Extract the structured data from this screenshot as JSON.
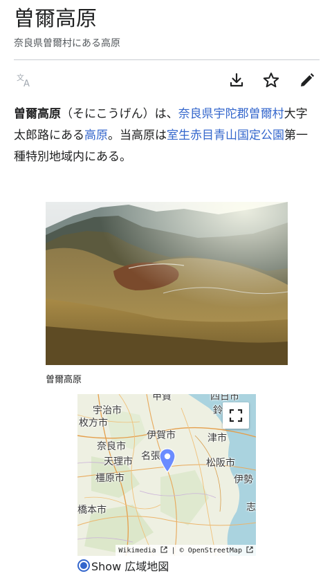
{
  "page": {
    "title": "曽爾高原",
    "subtitle": "奈良県曽爾村にある高原"
  },
  "actions": {
    "language_icon": "translate-icon",
    "download_icon": "download-icon",
    "watch_icon": "star-icon",
    "edit_icon": "pencil-icon"
  },
  "article": {
    "bold_term": "曽爾高原",
    "reading": "（そにこうげん）は、",
    "link_location": "奈良県宇陀郡曽爾村",
    "text_after_location": "大字太郎路にある",
    "link_kogen": "高原",
    "text_mid": "。当高原は",
    "link_park": "室生赤目青山国定公園",
    "text_end": "第一種特別地域内にある。"
  },
  "figure": {
    "caption": "曽爾高原"
  },
  "map": {
    "labels": {
      "kofu": "甲賀",
      "yokkaichi": "四日市",
      "uji": "宇治市",
      "hirakata": "枚方市",
      "suzuka": "鈴",
      "iga": "伊賀市",
      "tsu": "津市",
      "nara": "奈良市",
      "tenri": "天理市",
      "nabari": "名張",
      "matsusaka": "松阪市",
      "kashihara": "橿原市",
      "ise": "伊勢",
      "hashimoto": "橋本市",
      "shima": "志"
    },
    "fullscreen_icon": "fullscreen-icon",
    "pin_icon": "map-pin-icon",
    "attribution_wikimedia": "Wikimedia",
    "attribution_sep": "|",
    "attribution_osm": "© OpenStreetMap",
    "external_link_icon": "external-link-icon"
  },
  "show_toggle": {
    "label": "Show 広域地図"
  },
  "colors": {
    "link": "#3366cc",
    "text": "#202122",
    "muted": "#54595d",
    "pin": "#6b8cff"
  }
}
